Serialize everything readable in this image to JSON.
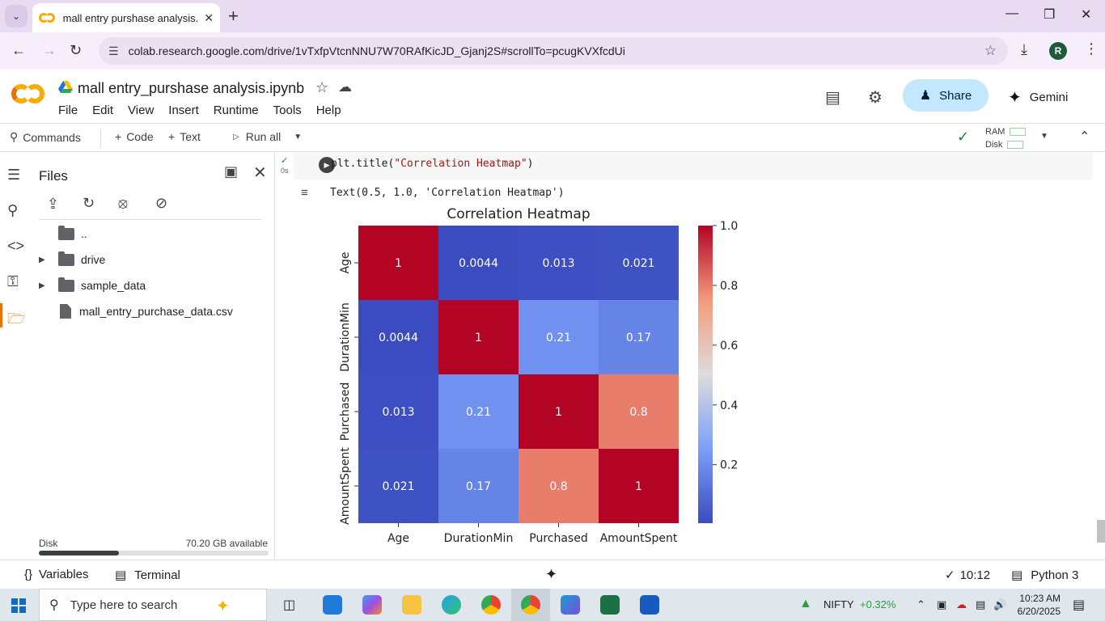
{
  "browser": {
    "tab_title": "mall entry purshase analysis.ipy",
    "url": "colab.research.google.com/drive/1vTxfpVtcnNNU7W70RAfKicJD_Gjanj2S#scrollTo=pcugKVXfcdUi",
    "profile_initial": "R"
  },
  "colab": {
    "notebook_title": "mall entry_purshase analysis.ipynb",
    "menu": [
      "File",
      "Edit",
      "View",
      "Insert",
      "Runtime",
      "Tools",
      "Help"
    ],
    "share_label": "Share",
    "gemini_label": "Gemini"
  },
  "toolbar": {
    "commands": "Commands",
    "code": "Code",
    "text": "Text",
    "run_all": "Run all",
    "ram_label": "RAM",
    "disk_label": "Disk"
  },
  "files": {
    "title": "Files",
    "items": [
      {
        "name": "..",
        "type": "parent"
      },
      {
        "name": "drive",
        "type": "folder"
      },
      {
        "name": "sample_data",
        "type": "folder"
      },
      {
        "name": "mall_entry_purchase_data.csv",
        "type": "file"
      }
    ],
    "disk_label": "Disk",
    "disk_available": "70.20 GB available",
    "disk_used_fraction": 0.35
  },
  "cell": {
    "status_time": "0s",
    "code_prefix": "plt.title(",
    "code_string": "\"Correlation Heatmap\"",
    "code_suffix": ")",
    "output_text": "Text(0.5, 1.0, 'Correlation Heatmap')"
  },
  "chart_data": {
    "type": "heatmap",
    "title": "Correlation Heatmap",
    "rows": [
      "Age",
      "DurationMin",
      "Purchased",
      "AmountSpent"
    ],
    "columns": [
      "Age",
      "DurationMin",
      "Purchased",
      "AmountSpent"
    ],
    "values": [
      [
        1,
        0.0044,
        0.013,
        0.021
      ],
      [
        0.0044,
        1,
        0.21,
        0.17
      ],
      [
        0.013,
        0.21,
        1,
        0.8
      ],
      [
        0.021,
        0.17,
        0.8,
        1
      ]
    ],
    "cell_labels": [
      [
        "1",
        "0.0044",
        "0.013",
        "0.021"
      ],
      [
        "0.0044",
        "1",
        "0.21",
        "0.17"
      ],
      [
        "0.013",
        "0.21",
        "1",
        "0.8"
      ],
      [
        "0.021",
        "0.17",
        "0.8",
        "1"
      ]
    ],
    "colormap": "coolwarm",
    "colorbar_range": [
      0.0044,
      1.0
    ],
    "colorbar_ticks": [
      "1.0",
      "0.8",
      "0.6",
      "0.4",
      "0.2"
    ],
    "colorbar_tick_values": [
      1.0,
      0.8,
      0.6,
      0.4,
      0.2
    ]
  },
  "statusbar": {
    "variables": "Variables",
    "terminal": "Terminal",
    "time": "10:12",
    "runtime": "Python 3"
  },
  "taskbar": {
    "search_placeholder": "Type here to search",
    "nifty_label": "NIFTY",
    "nifty_change": "+0.32%",
    "clock_time": "10:23 AM",
    "clock_date": "6/20/2025"
  }
}
